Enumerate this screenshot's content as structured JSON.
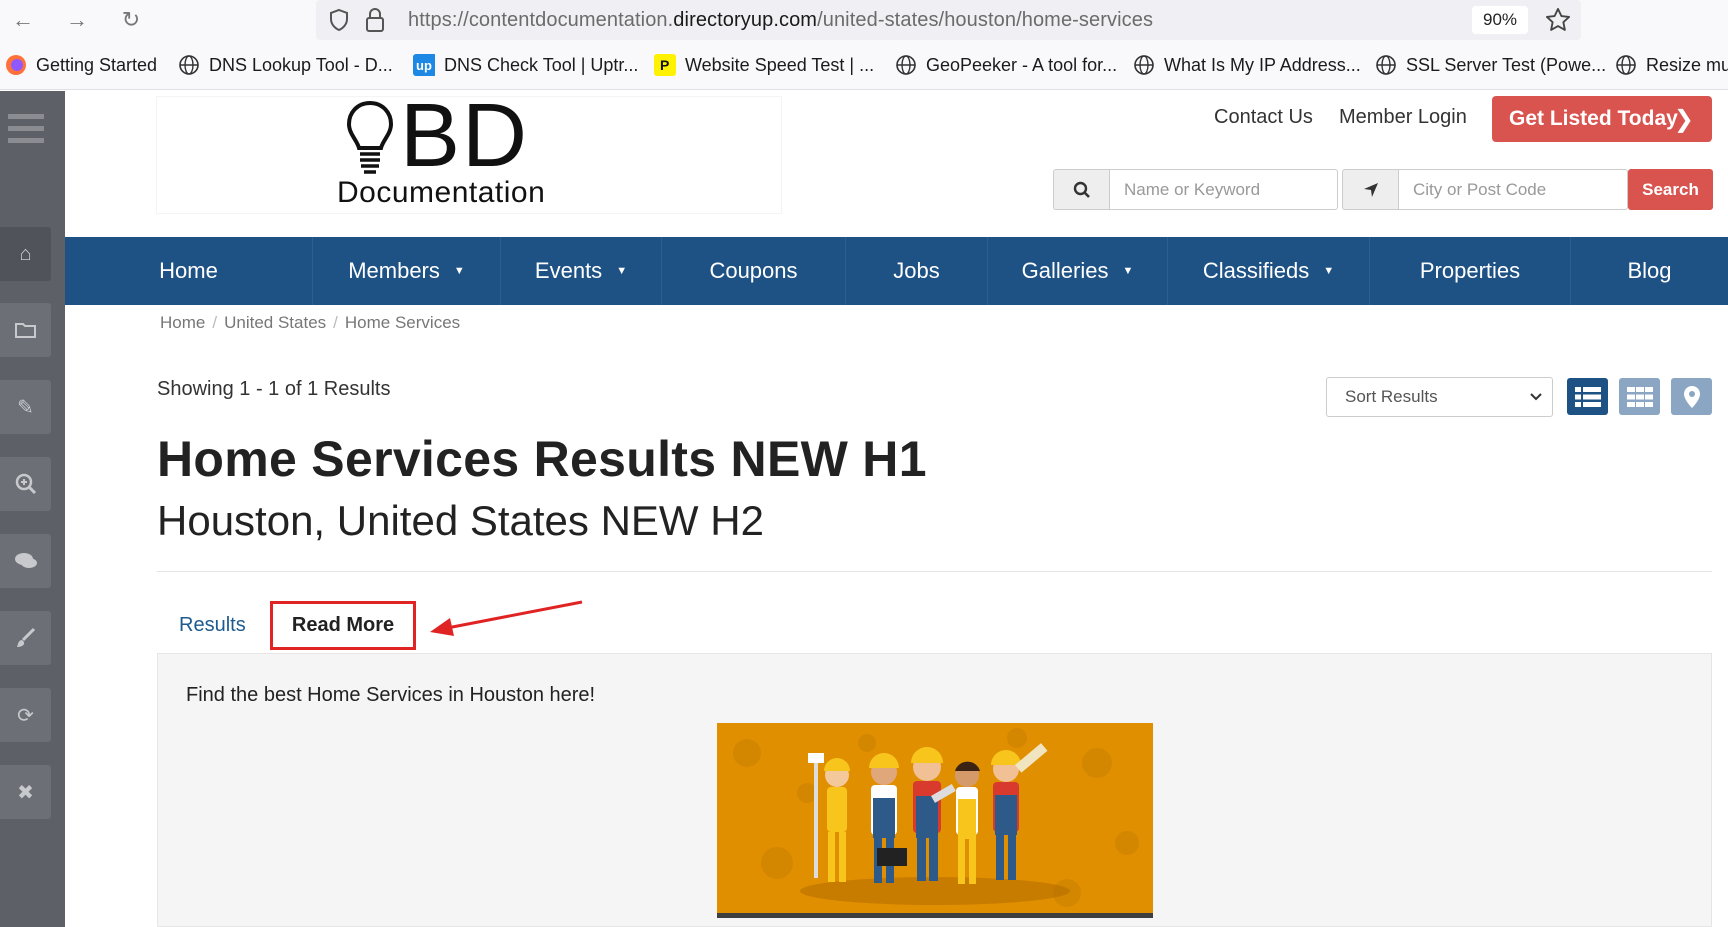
{
  "browser": {
    "url_prefix": "https://contentdocumentation.",
    "url_domain": "directoryup.com",
    "url_path": "/united-states/houston/home-services",
    "zoom": "90%",
    "bookmarks": [
      "Getting Started",
      "DNS Lookup Tool - D...",
      "DNS Check Tool | Uptr...",
      "Website Speed Test | ...",
      "GeoPeeker - A tool for...",
      "What Is My IP Address...",
      "SSL Server Test (Powe...",
      "Resize mu"
    ]
  },
  "header": {
    "logo_letters": "BD",
    "logo_word": "Documentation",
    "contact_label": "Contact Us",
    "login_label": "Member Login",
    "cta_label": "Get Listed Today"
  },
  "search": {
    "keyword_placeholder": "Name or Keyword",
    "location_placeholder": "City or Post Code",
    "button_label": "Search"
  },
  "nav": {
    "items": [
      "Home",
      "Members",
      "Events",
      "Coupons",
      "Jobs",
      "Galleries",
      "Classifieds",
      "Properties",
      "Blog"
    ]
  },
  "breadcrumb": [
    "Home",
    "United States",
    "Home Services"
  ],
  "results": {
    "showing": "Showing 1 - 1 of 1 Results",
    "sort_label": "Sort Results",
    "h1": "Home Services Results NEW H1",
    "h2": "Houston, United States NEW H2"
  },
  "tabs": {
    "results": "Results",
    "read_more": "Read More"
  },
  "panel": {
    "text": "Find the best Home Services in Houston here!"
  },
  "colors": {
    "nav_blue": "#1f5284",
    "cta_red": "#d9534f",
    "annotation_red": "#e02424",
    "sidebar_gray": "#5d6067"
  }
}
